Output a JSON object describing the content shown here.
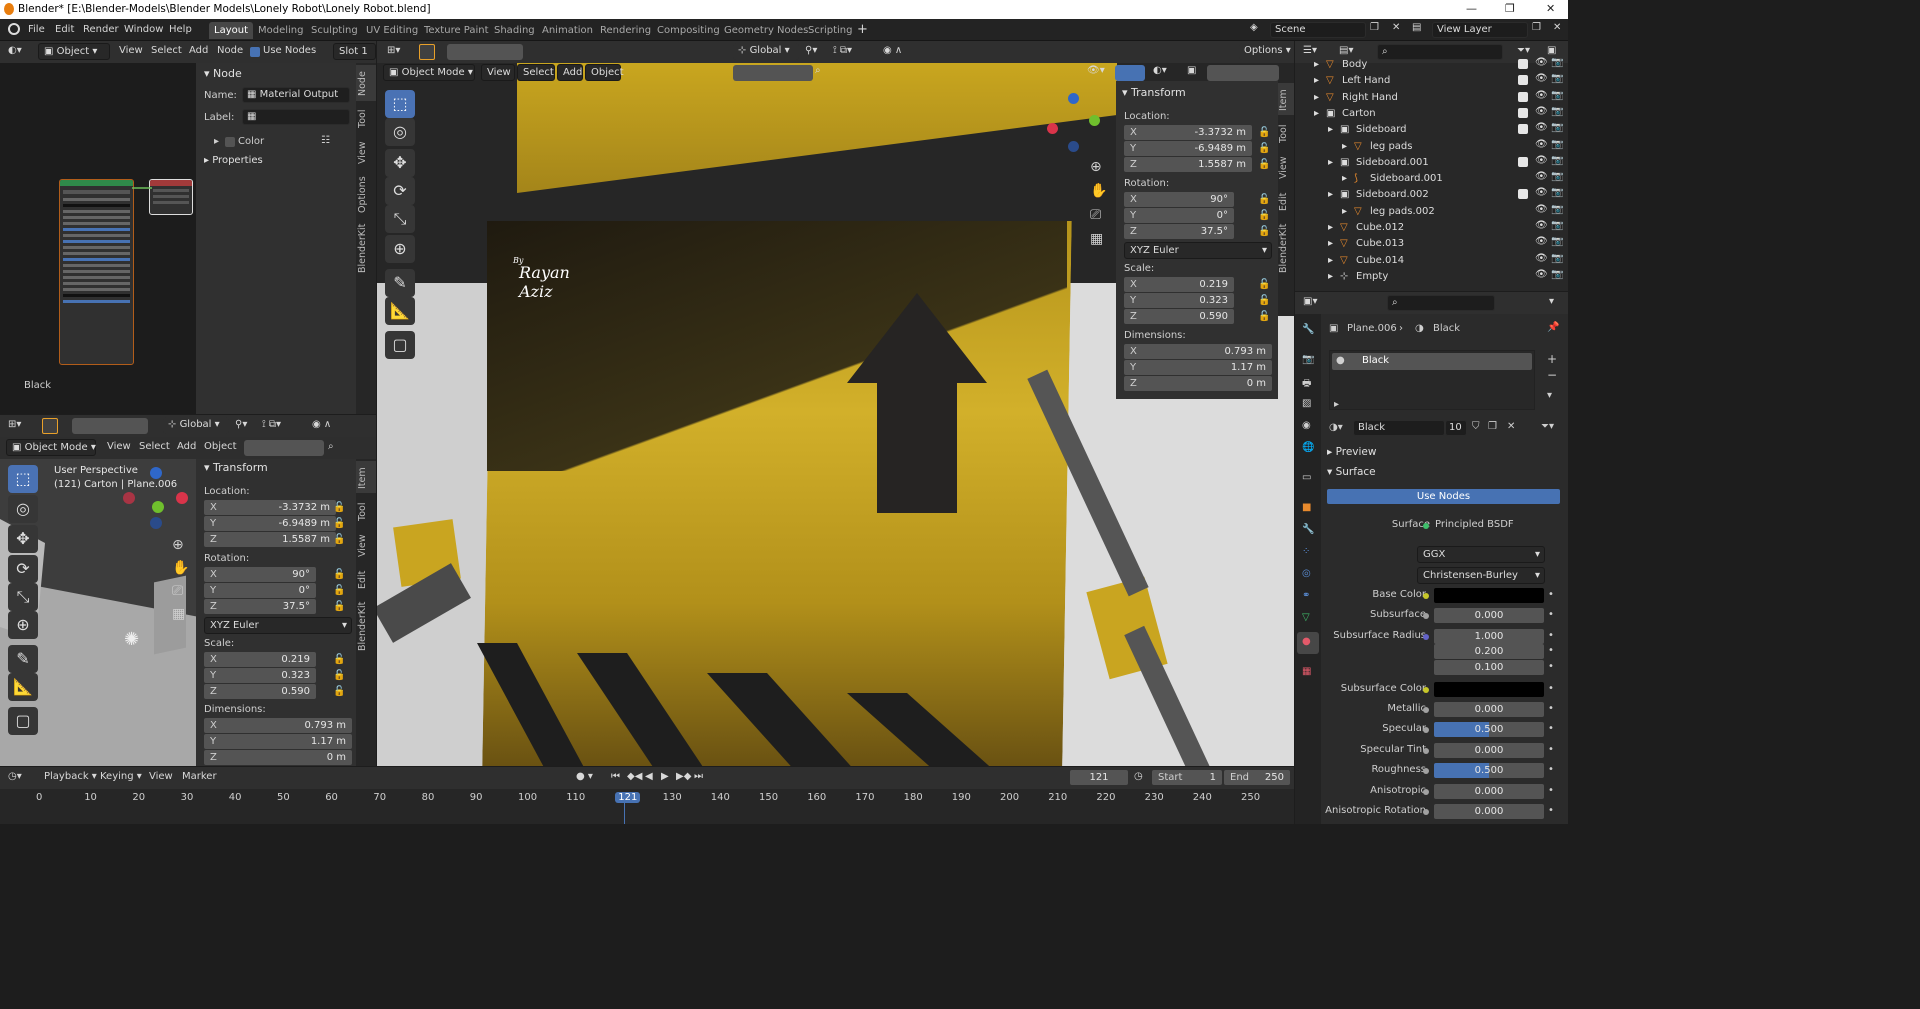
{
  "title_bar": {
    "text": "Blender* [E:\\Blender-Models\\Blender Models\\Lonely Robot\\Lonely Robot.blend]"
  },
  "menu": [
    "File",
    "Edit",
    "Render",
    "Window",
    "Help"
  ],
  "workspaces": [
    "Layout",
    "Modeling",
    "Sculpting",
    "UV Editing",
    "Texture Paint",
    "Shading",
    "Animation",
    "Rendering",
    "Compositing",
    "Geometry Nodes",
    "Scripting"
  ],
  "scene": {
    "label": "Scene",
    "view_layer": "View Layer"
  },
  "node_editor": {
    "header": {
      "mode": "Object",
      "view": "View",
      "select": "Select",
      "add": "Add",
      "node": "Node",
      "use_nodes": "Use Nodes",
      "slot": "Slot 1"
    },
    "tabs": [
      "Node",
      "Tool",
      "View",
      "Options",
      "BlenderKit"
    ],
    "panel": {
      "title": "Node",
      "name_label": "Name:",
      "name_value": "Material Output",
      "label_label": "Label:",
      "color": "Color",
      "properties": "Properties"
    },
    "material_label": "Black"
  },
  "mini_viewport": {
    "header": {
      "orientation": "Global",
      "mode": "Object Mode",
      "view": "View",
      "select": "Select",
      "add": "Add",
      "object": "Object"
    },
    "info_line1": "User Perspective",
    "info_line2": "(121) Carton | Plane.006"
  },
  "transform": {
    "title": "Transform",
    "location_label": "Location:",
    "location": [
      {
        "axis": "X",
        "value": "-3.3732 m"
      },
      {
        "axis": "Y",
        "value": "-6.9489 m"
      },
      {
        "axis": "Z",
        "value": "1.5587 m"
      }
    ],
    "rotation_label": "Rotation:",
    "rotation": [
      {
        "axis": "X",
        "value": "90°"
      },
      {
        "axis": "Y",
        "value": "0°"
      },
      {
        "axis": "Z",
        "value": "37.5°"
      }
    ],
    "rotation_mode": "XYZ Euler",
    "scale_label": "Scale:",
    "scale": [
      {
        "axis": "X",
        "value": "0.219"
      },
      {
        "axis": "Y",
        "value": "0.323"
      },
      {
        "axis": "Z",
        "value": "0.590"
      }
    ],
    "dimensions_label": "Dimensions:",
    "dimensions": [
      {
        "axis": "X",
        "value": "0.793 m"
      },
      {
        "axis": "Y",
        "value": "1.17 m"
      },
      {
        "axis": "Z",
        "value": "0 m"
      }
    ]
  },
  "side_tabs": [
    "Item",
    "Tool",
    "View",
    "Edit",
    "BlenderKit"
  ],
  "main_viewport": {
    "header": {
      "mode": "Object Mode",
      "view": "View",
      "select": "Select",
      "add": "Add",
      "object": "Object",
      "orientation": "Global",
      "options": "Options"
    },
    "watermark_by": "By",
    "watermark_name1": "Rayan",
    "watermark_name2": "Aziz"
  },
  "outliner": {
    "rows": [
      {
        "name": "Body",
        "indent": 1,
        "checkbox": true
      },
      {
        "name": "Left Hand",
        "indent": 1,
        "checkbox": true
      },
      {
        "name": "Right Hand",
        "indent": 1,
        "checkbox": true
      },
      {
        "name": "Carton",
        "indent": 1,
        "checkbox": true
      },
      {
        "name": "Sideboard",
        "indent": 2,
        "checkbox": true
      },
      {
        "name": "leg pads",
        "indent": 3,
        "checkbox": false
      },
      {
        "name": "Sideboard.001",
        "indent": 2,
        "checkbox": true
      },
      {
        "name": "Sideboard.001",
        "indent": 3,
        "checkbox": false
      },
      {
        "name": "Sideboard.002",
        "indent": 2,
        "checkbox": true
      },
      {
        "name": "leg pads.002",
        "indent": 3,
        "checkbox": false
      },
      {
        "name": "Cube.012",
        "indent": 2,
        "checkbox": false
      },
      {
        "name": "Cube.013",
        "indent": 2,
        "checkbox": false
      },
      {
        "name": "Cube.014",
        "indent": 2,
        "checkbox": false
      },
      {
        "name": "Empty",
        "indent": 2,
        "checkbox": false
      }
    ]
  },
  "properties": {
    "object": "Plane.006",
    "material": "Black",
    "slot_name": "Black",
    "users": "10",
    "preview": "Preview",
    "surface_panel": "Surface",
    "use_nodes": "Use Nodes",
    "surface_label": "Surface",
    "surface_value": "Principled BSDF",
    "distribution": "GGX",
    "subsurface_method": "Christensen-Burley",
    "fields": [
      {
        "label": "Base Color",
        "value": "",
        "dot": "#c7c729",
        "kind": "color",
        "color": "#000000"
      },
      {
        "label": "Subsurface",
        "value": "0.000",
        "dot": "#a1a1a1",
        "kind": "num"
      },
      {
        "label": "Subsurface Radius",
        "value": "1.000",
        "dot": "#6363c7",
        "kind": "num"
      },
      {
        "label": "",
        "value": "0.200",
        "dot": "",
        "kind": "num"
      },
      {
        "label": "",
        "value": "0.100",
        "dot": "",
        "kind": "num"
      },
      {
        "label": "Subsurface Color",
        "value": "",
        "dot": "#c7c729",
        "kind": "color",
        "color": "#000000"
      },
      {
        "label": "Metallic",
        "value": "0.000",
        "dot": "#a1a1a1",
        "kind": "num"
      },
      {
        "label": "Specular",
        "value": "0.500",
        "dot": "#a1a1a1",
        "kind": "slider",
        "fill": 0.5
      },
      {
        "label": "Specular Tint",
        "value": "0.000",
        "dot": "#a1a1a1",
        "kind": "num"
      },
      {
        "label": "Roughness",
        "value": "0.500",
        "dot": "#a1a1a1",
        "kind": "slider",
        "fill": 0.5
      },
      {
        "label": "Anisotropic",
        "value": "0.000",
        "dot": "#a1a1a1",
        "kind": "num"
      },
      {
        "label": "Anisotropic Rotation",
        "value": "0.000",
        "dot": "#a1a1a1",
        "kind": "num"
      }
    ]
  },
  "timeline": {
    "playback": "Playback",
    "keying": "Keying",
    "view": "View",
    "marker": "Marker",
    "current_frame": "121",
    "start_label": "Start",
    "start": "1",
    "end_label": "End",
    "end": "250",
    "ticks": [
      "0",
      "10",
      "20",
      "30",
      "40",
      "50",
      "60",
      "70",
      "80",
      "90",
      "100",
      "110",
      "121",
      "130",
      "140",
      "150",
      "160",
      "170",
      "180",
      "190",
      "200",
      "210",
      "220",
      "230",
      "240",
      "250"
    ]
  },
  "colors": {
    "accent": "#4772b3",
    "header": "#303030",
    "panel": "#2b2b2b",
    "yellow": "#c9a520"
  }
}
